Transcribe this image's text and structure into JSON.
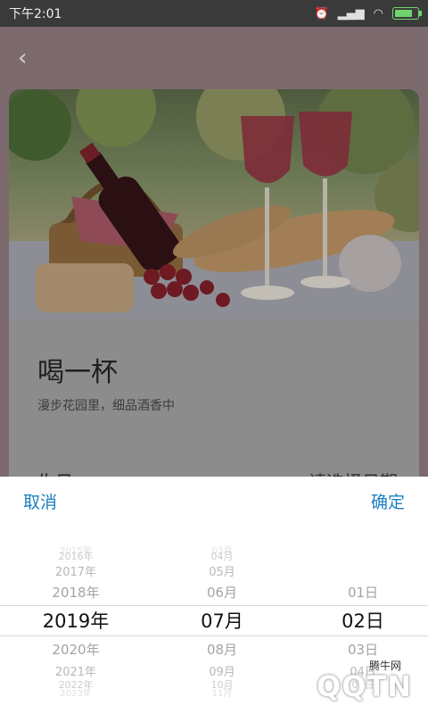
{
  "status_bar": {
    "time": "下午2:01",
    "icons": [
      "alarm-off-icon",
      "signal-icon",
      "wifi-icon",
      "battery-icon"
    ],
    "battery_level": 0.85
  },
  "nav": {
    "back_icon": "chevron-left-icon"
  },
  "card": {
    "title": "喝一杯",
    "subtitle": "漫步花园里，细品酒香中",
    "row_left": "生日",
    "row_right": "请选择日期"
  },
  "picker": {
    "cancel_label": "取消",
    "confirm_label": "确定",
    "years": [
      "2015年",
      "2016年",
      "2017年",
      "2018年",
      "2019年",
      "2020年",
      "2021年",
      "2022年",
      "2023年"
    ],
    "months": [
      "03月",
      "04月",
      "05月",
      "06月",
      "07月",
      "08月",
      "09月",
      "10月",
      "11月"
    ],
    "days": [
      "01日",
      "02日",
      "03日",
      "04日",
      "05日"
    ],
    "selected": {
      "year": "2019年",
      "month": "07月",
      "day": "02日"
    }
  },
  "watermark": {
    "text": "QQTN",
    "small": "腾牛网"
  }
}
